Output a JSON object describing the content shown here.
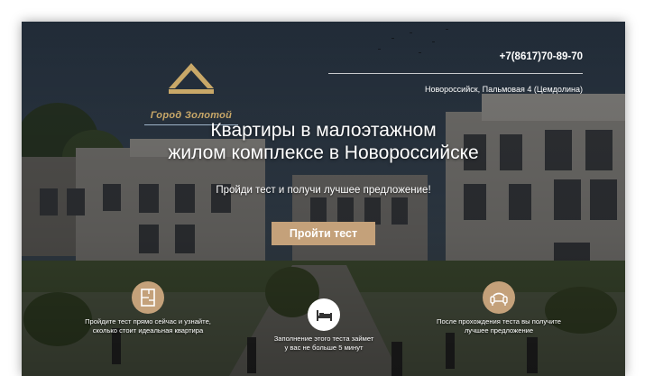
{
  "header": {
    "logo_text": "Город Золотой",
    "phone": "+7(8617)70-89-70",
    "address": "Новороссийск, Пальмовая 4 (Цемдолина)"
  },
  "hero": {
    "title_line1": "Квартиры в малоэтажном",
    "title_line2": "жилом комплексе в Новороссийске",
    "subtitle": "Пройди тест и получи лучшее предложение!",
    "cta_label": "Пройти тест"
  },
  "features": [
    {
      "icon": "floor-plan-icon",
      "line1": "Пройдите тест прямо сейчас и узнайте,",
      "line2": "сколько стоит идеальная квартира"
    },
    {
      "icon": "bed-icon",
      "line1": "Заполнение этого теста займет",
      "line2": "у вас не больше 5 минут"
    },
    {
      "icon": "sofa-icon",
      "line1": "После прохождения теста вы получите",
      "line2": "лучшее предложение"
    }
  ],
  "colors": {
    "accent": "#c4a17a",
    "icon_white_bg": "#ffffff"
  }
}
